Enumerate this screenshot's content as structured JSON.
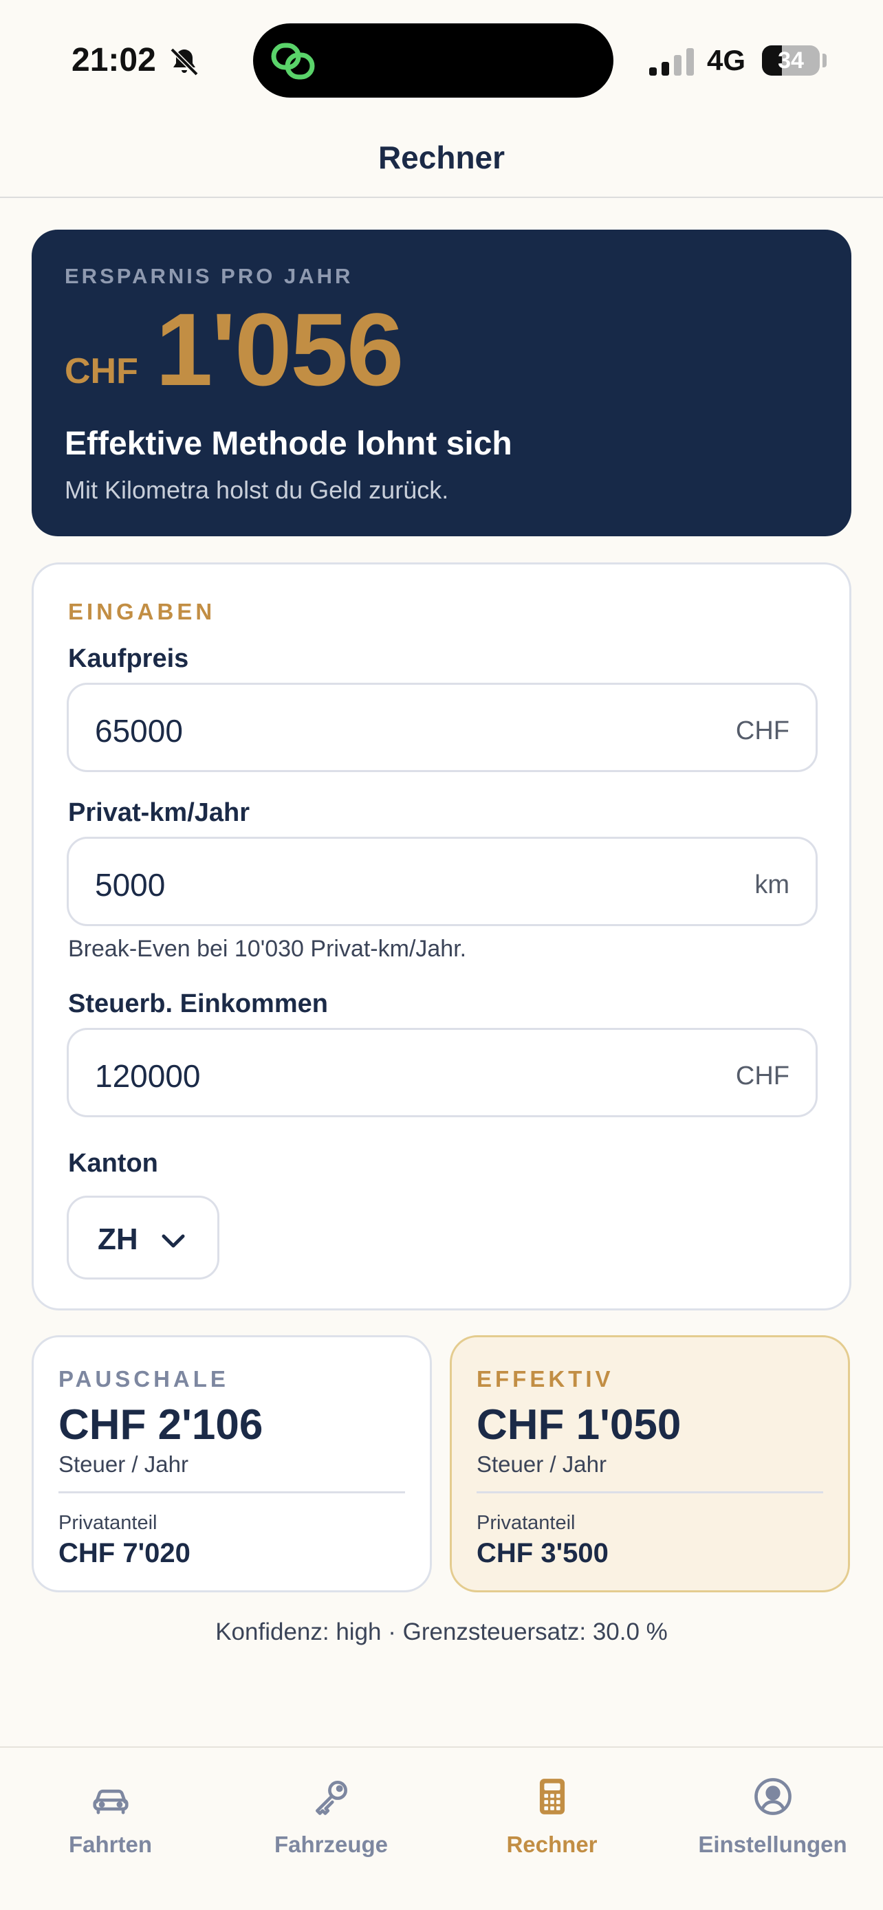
{
  "status_bar": {
    "time": "21:02",
    "network": "4G",
    "battery": "34",
    "battery_level": 0.34
  },
  "nav": {
    "title": "Rechner"
  },
  "hero": {
    "label": "ERSPARNIS PRO JAHR",
    "currency": "CHF",
    "amount": "1'056",
    "headline": "Effektive Methode lohnt sich",
    "subline": "Mit Kilometra holst du Geld zurück."
  },
  "inputs": {
    "section_label": "EINGABEN",
    "kaufpreis": {
      "label": "Kaufpreis",
      "value": "65000",
      "unit": "CHF"
    },
    "privat_km": {
      "label": "Privat-km/Jahr",
      "value": "5000",
      "unit": "km",
      "hint": "Break-Even bei 10'030 Privat-km/Jahr."
    },
    "einkommen": {
      "label": "Steuerb. Einkommen",
      "value": "120000",
      "unit": "CHF"
    },
    "kanton": {
      "label": "Kanton",
      "value": "ZH"
    }
  },
  "compare": {
    "pauschale": {
      "label": "PAUSCHALE",
      "value": "CHF 2'106",
      "sub": "Steuer / Jahr",
      "privat_label": "Privatanteil",
      "privat_value": "CHF 7'020"
    },
    "effektiv": {
      "label": "EFFEKTIV",
      "value": "CHF 1'050",
      "sub": "Steuer / Jahr",
      "privat_label": "Privatanteil",
      "privat_value": "CHF 3'500"
    }
  },
  "footnote": "Konfidenz: high · Grenzsteuersatz: 30.0 %",
  "tabs": [
    {
      "label": "Fahrten",
      "icon": "car-icon"
    },
    {
      "label": "Fahrzeuge",
      "icon": "key-icon"
    },
    {
      "label": "Rechner",
      "icon": "calculator-icon",
      "active": true
    },
    {
      "label": "Einstellungen",
      "icon": "user-circle-icon"
    }
  ],
  "colors": {
    "accent": "#c28e44",
    "navy": "#172948",
    "inactive": "#7d87a0",
    "background": "#fcfaf5"
  }
}
